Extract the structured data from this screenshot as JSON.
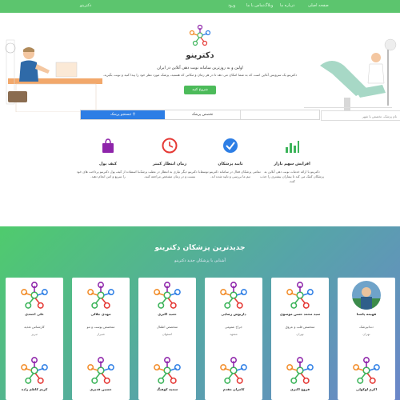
{
  "topbar": {
    "brand": "دکترینو",
    "nav": [
      "صفحه اصلی",
      "درباره ما",
      "وبلاگ",
      "تماس با ما",
      "ورود"
    ]
  },
  "hero": {
    "title": "دکترینو",
    "tagline": "اولین و به روزترین سامانه نوبت دهی آنلاین در ایران",
    "description": "دکترینو یک سرویس آنلاین است که به شما امکان می دهد تا در هر زمان و مکانی که هستید، پزشک مورد نظر خود را پیدا کنید و نوبت بگیرید.",
    "button": "شروع کنید",
    "search_button": "جستجو پزشک",
    "search_middle": "تخصص پزشک",
    "search_placeholder": "نام پزشک، تخصص یا شهر"
  },
  "features": [
    {
      "title": "افزایش سهم بازار",
      "text": "دکترینو با ارائه خدمات نوبت دهی آنلاین به پزشکان کمک می کند تا بیماران بیشتری را جذب کنند.",
      "icon": "bar-chart-icon",
      "color": "#3cb45a"
    },
    {
      "title": "تایید پزشکان",
      "text": "تمامی پزشکان فعال در سامانه دکترینو توسط تیم ما بررسی و تایید شده اند.",
      "icon": "check-circle-icon",
      "color": "#2d7ee5"
    },
    {
      "title": "زمان انتظار کمتر",
      "text": "با دکترینو دیگر نیازی به انتظار در مطب پزشک نیست و در زمان مشخص مراجعه کنید.",
      "icon": "clock-icon",
      "color": "#e53935"
    },
    {
      "title": "کیف پول",
      "text": "با استفاده از کیف پول دکترینو پرداخت های خود را سریع و امن انجام دهید.",
      "icon": "bag-icon",
      "color": "#8e24aa"
    }
  ],
  "doctors": {
    "title": "جدیدترین پزشکان دکترینو",
    "subtitle": "آشنایی با پزشکان جدید دکترینو",
    "row1": [
      {
        "name": "فهیمه پاشنا",
        "spec": "دندانپزشک",
        "city": "تهران",
        "photo": true
      },
      {
        "name": "سید محمد حسن موسوی",
        "spec": "متخصص قلب و عروق",
        "city": "تهران",
        "photo": false
      },
      {
        "name": "داریوش رضایی",
        "spec": "جراح عمومی",
        "city": "مشهد",
        "photo": false
      },
      {
        "name": "حمید اکبری",
        "spec": "متخصص اطفال",
        "city": "اصفهان",
        "photo": false
      },
      {
        "name": "مهدی جلالی",
        "spec": "متخصص پوست و مو",
        "city": "شیراز",
        "photo": false
      },
      {
        "name": "علی احمدی",
        "spec": "کارشناس تغذیه",
        "city": "تبریز",
        "photo": false
      }
    ],
    "row2": [
      {
        "name": "اکرم لوکولی",
        "spec": "",
        "city": "",
        "photo": false
      },
      {
        "name": "فروغ اکبری",
        "spec": "",
        "city": "",
        "photo": false
      },
      {
        "name": "کامران مقدم",
        "spec": "",
        "city": "",
        "photo": false
      },
      {
        "name": "سمیه کوهیگ",
        "spec": "",
        "city": "",
        "photo": false
      },
      {
        "name": "حسین قدیری",
        "spec": "",
        "city": "",
        "photo": false
      },
      {
        "name": "کریم کاظم زاده",
        "spec": "",
        "city": "",
        "photo": false
      }
    ]
  },
  "colors": {
    "green": "#5cc56e",
    "blue": "#2d7ee5",
    "purple": "#8e24aa"
  }
}
